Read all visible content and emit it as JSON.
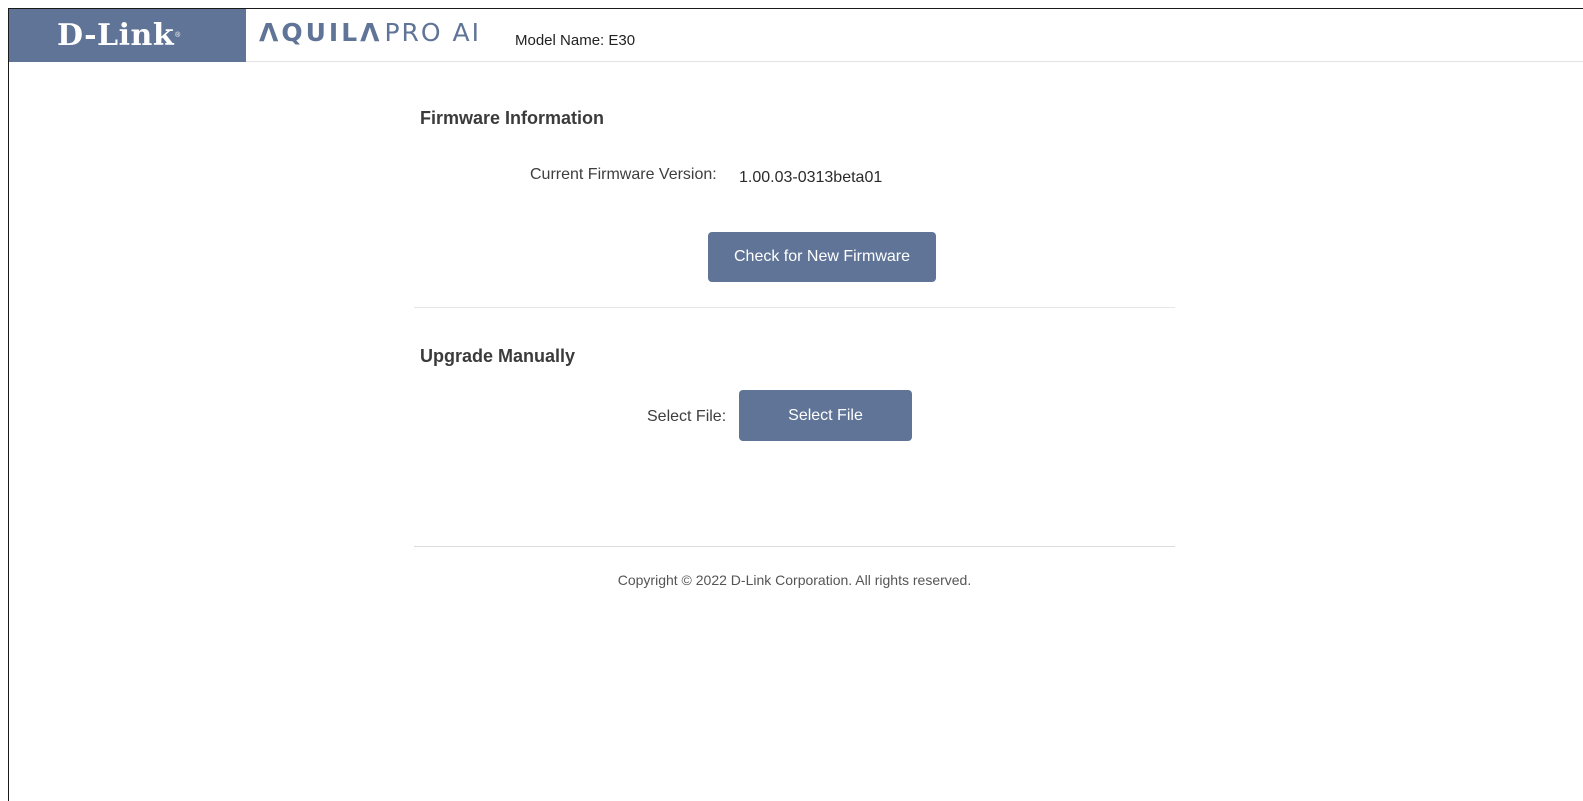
{
  "header": {
    "logo": "D-Link",
    "logo_reg": "®",
    "brand_bold": "ΛQUILΛ",
    "brand_light": "PRO AI",
    "model_name": "Model Name: E30"
  },
  "firmware": {
    "title": "Firmware Information",
    "current_label": "Current Firmware Version:",
    "current_value": "1.00.03-0313beta01",
    "check_button": "Check for New Firmware"
  },
  "upgrade": {
    "title": "Upgrade Manually",
    "select_label": "Select File:",
    "select_button": "Select File"
  },
  "footer": {
    "copyright": "Copyright © 2022 D-Link Corporation. All rights reserved."
  },
  "colors": {
    "brand": "#5f7496",
    "background": "#ffffff"
  }
}
